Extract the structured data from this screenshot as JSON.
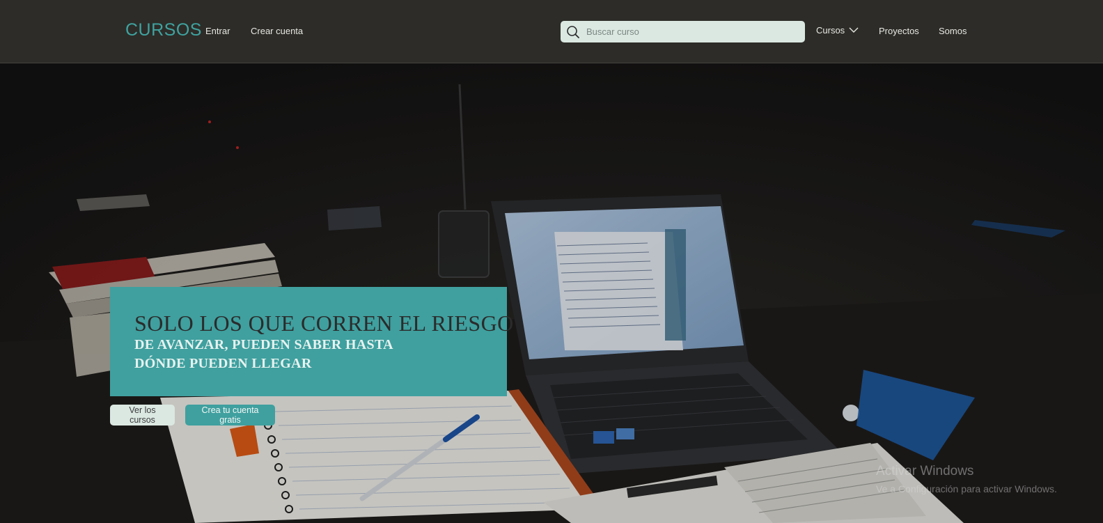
{
  "header": {
    "brand": "CURSOS",
    "login_link": "Entrar",
    "signup_link": "Crear cuenta",
    "search": {
      "placeholder": "Buscar curso",
      "value": ""
    },
    "courses_dropdown": "Cursos",
    "projects_link": "Proyectos",
    "about_link": "Somos"
  },
  "hero": {
    "title": "SOLO LOS QUE CORREN EL RIESGO",
    "subtitle_line1": "DE AVANZAR, PUEDEN SABER HASTA",
    "subtitle_line2": "DÓNDE PUEDEN LLEGAR",
    "view_courses_button": "Ver los cursos",
    "create_account_button": "Crea tu cuenta gratis"
  },
  "windows_watermark": {
    "line1": "Activar Windows",
    "line2": "Ve a Configuración para activar Windows."
  },
  "colors": {
    "navbar_bg": "#2d2c28",
    "accent_teal": "#3fa09f",
    "search_bg": "#dbe8e2"
  }
}
